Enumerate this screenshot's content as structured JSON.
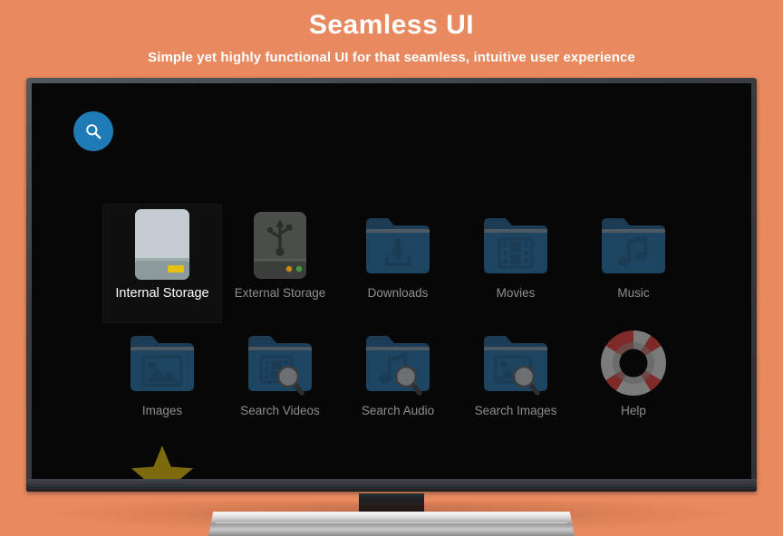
{
  "header": {
    "title": "Seamless UI",
    "subtitle": "Simple yet highly functional UI for that seamless, intuitive user experience"
  },
  "colors": {
    "background": "#e8895f",
    "screen": "#070707",
    "accent_blue": "#1f7bb6",
    "folder_blue": "#1d4561",
    "folder_tab": "#4d5a63",
    "label_gray": "#8e8e8e",
    "label_selected": "#ffffff",
    "drive_light": "#c2ccd1",
    "drive_base": "#8b9a9a",
    "drive_led": "#e8c011",
    "usb_body": "#4a4d4a",
    "help_red": "#7d2a28",
    "help_gray": "#7b7b7b",
    "star_gold": "#7d6a0c",
    "tv_bezel": "#3a3d42",
    "tv_base": "#c9c9c9"
  },
  "toolbar": {
    "search": {
      "label": "Search",
      "icon": "search-icon"
    }
  },
  "main": {
    "rows": [
      {
        "items": [
          {
            "label": "Internal Storage",
            "icon": "internal-storage-icon",
            "selected": true
          },
          {
            "label": "External Storage",
            "icon": "external-storage-usb-icon",
            "selected": false
          },
          {
            "label": "Downloads",
            "icon": "folder-download-icon",
            "selected": false
          },
          {
            "label": "Movies",
            "icon": "folder-film-icon",
            "selected": false
          },
          {
            "label": "Music",
            "icon": "folder-music-note-icon",
            "selected": false
          }
        ]
      },
      {
        "items": [
          {
            "label": "Images",
            "icon": "folder-picture-icon",
            "selected": false
          },
          {
            "label": "Search Videos",
            "icon": "folder-film-search-icon",
            "selected": false
          },
          {
            "label": "Search Audio",
            "icon": "folder-music-search-icon",
            "selected": false
          },
          {
            "label": "Search Images",
            "icon": "folder-picture-search-icon",
            "selected": false
          },
          {
            "label": "Help",
            "icon": "lifebuoy-help-icon",
            "selected": false
          }
        ]
      }
    ],
    "partial_row": {
      "items": [
        {
          "label": "",
          "icon": "star-favorites-icon",
          "selected": false
        }
      ]
    }
  }
}
